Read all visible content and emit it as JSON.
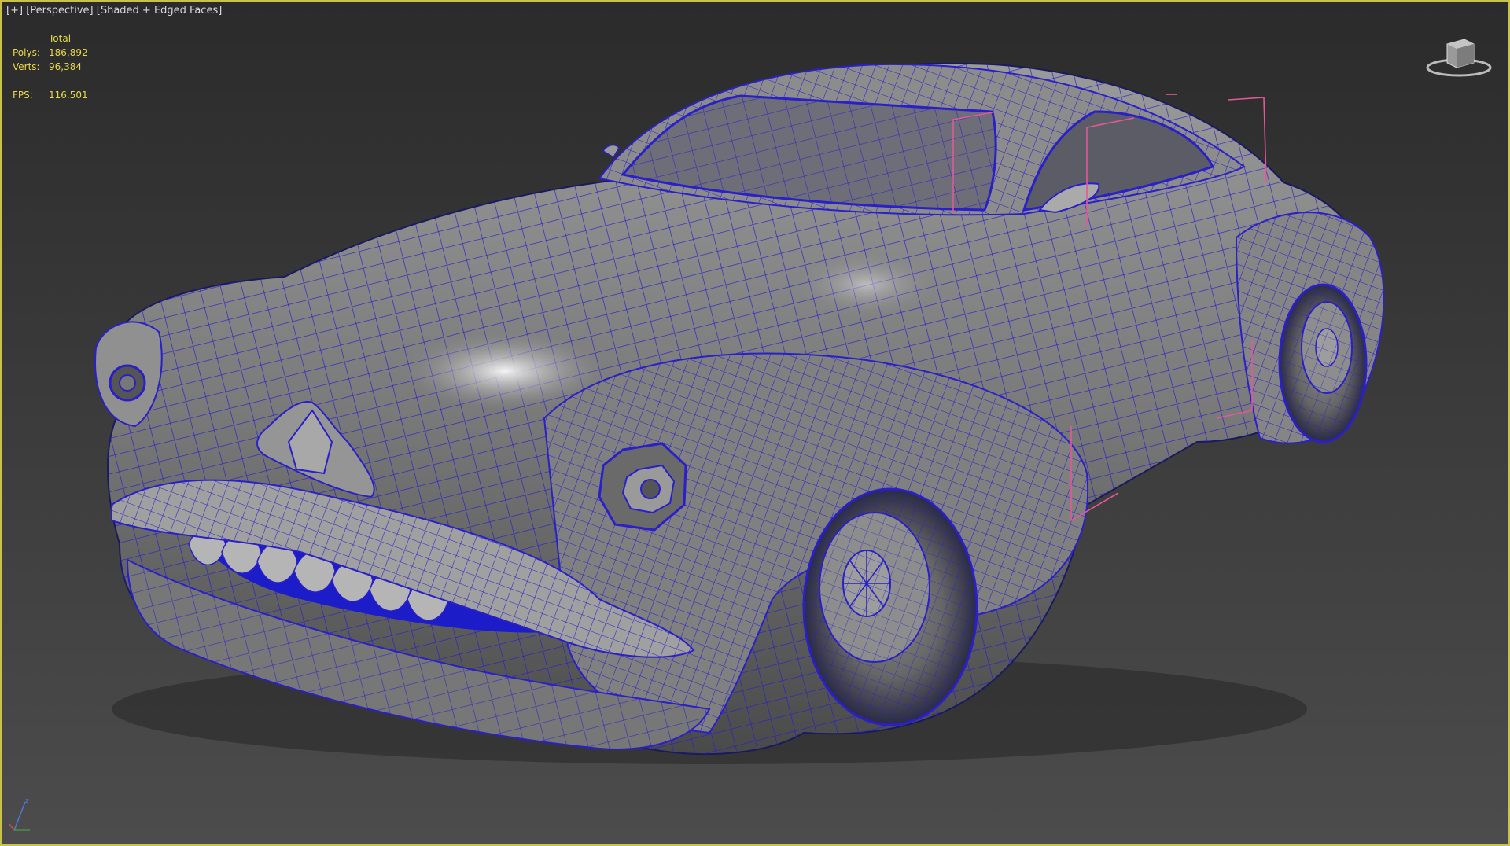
{
  "viewport": {
    "menu_plus": "[+]",
    "menu_view": "[Perspective]",
    "menu_shading": "[Shaded + Edged Faces]",
    "stats": {
      "header": "Total",
      "polys_label": "Polys:",
      "polys_value": "186,892",
      "verts_label": "Verts:",
      "verts_value": "96,384",
      "fps_label": "FPS:",
      "fps_value": "116.501"
    },
    "viewcube_icon": "viewcube-icon",
    "axis_gizmo_icon": "xyz-axis-icon"
  },
  "colors": {
    "viewport_border": "#c9c24a",
    "stats_text": "#e8d84a",
    "wire_edges": "#2a1fc8",
    "selection_brackets": "#e05a9a"
  }
}
